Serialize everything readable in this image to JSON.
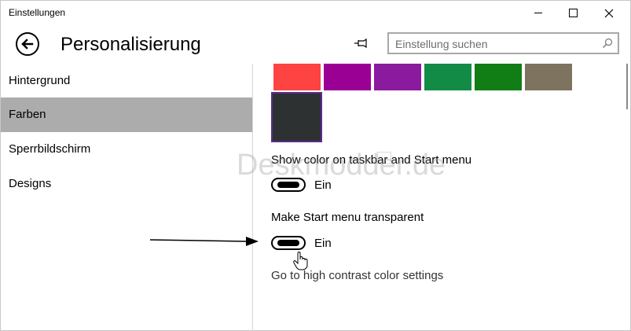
{
  "titlebar": {
    "title": "Einstellungen",
    "buttons": [
      "minimize",
      "maximize",
      "close"
    ]
  },
  "header": {
    "title": "Personalisierung",
    "back_icon": "back-arrow-icon",
    "pin_icon": "pin-icon",
    "search": {
      "placeholder": "Einstellung suchen",
      "value": "",
      "icon": "search-icon"
    }
  },
  "nav": {
    "items": [
      {
        "label": "Hintergrund",
        "selected": false
      },
      {
        "label": "Farben",
        "selected": true
      },
      {
        "label": "Sperrbildschirm",
        "selected": false
      },
      {
        "label": "Designs",
        "selected": false
      }
    ]
  },
  "colors": {
    "swatches": [
      "#fe4343",
      "#9b0095",
      "#8a1a9e",
      "#118b46",
      "#117d15",
      "#7e735f"
    ],
    "selected_swatch": "#2d3132"
  },
  "settings": {
    "taskbar_color": {
      "label": "Show color on taskbar and Start menu",
      "state": "Ein"
    },
    "start_transparent": {
      "label": "Make Start menu transparent",
      "state": "Ein"
    },
    "high_contrast_link": "Go to high contrast color settings"
  },
  "watermark": "Deskmodder.de"
}
